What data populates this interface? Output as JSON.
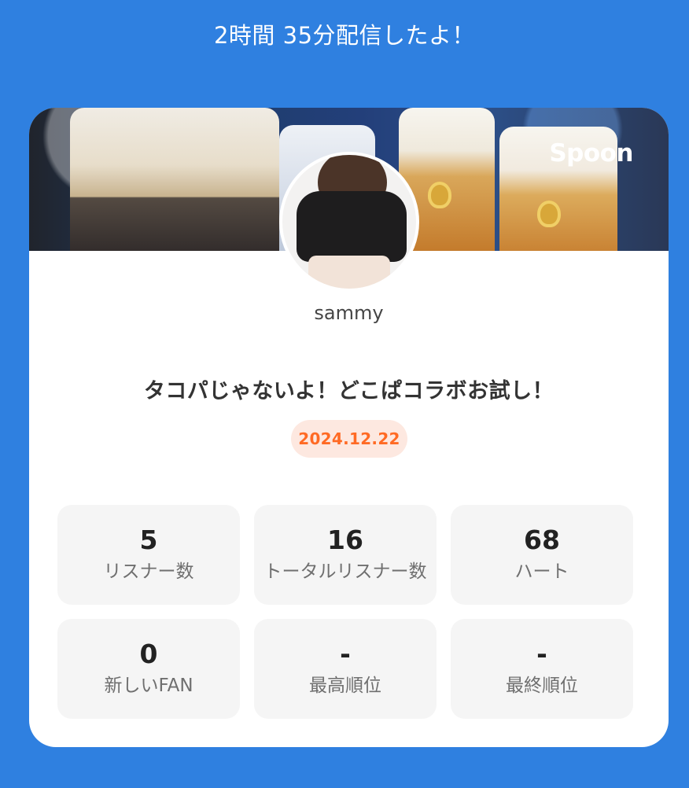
{
  "header": {
    "title": "2時間 35分配信したよ！"
  },
  "card": {
    "brand": "Spoon",
    "username": "sammy",
    "stream_title": "タコパじゃないよ！どこぱコラボお試し！",
    "date": "2024.12.22",
    "stats": [
      {
        "value": "5",
        "label": "リスナー数"
      },
      {
        "value": "16",
        "label": "トータルリスナー数"
      },
      {
        "value": "68",
        "label": "ハート"
      },
      {
        "value": "0",
        "label": "新しいFAN"
      },
      {
        "value": "-",
        "label": "最高順位"
      },
      {
        "value": "-",
        "label": "最終順位"
      }
    ]
  },
  "colors": {
    "background": "#2f80e0",
    "card": "#ffffff",
    "accent": "#ff6a24",
    "date_badge_bg": "#fde8e0",
    "stat_box_bg": "#f5f5f5"
  }
}
